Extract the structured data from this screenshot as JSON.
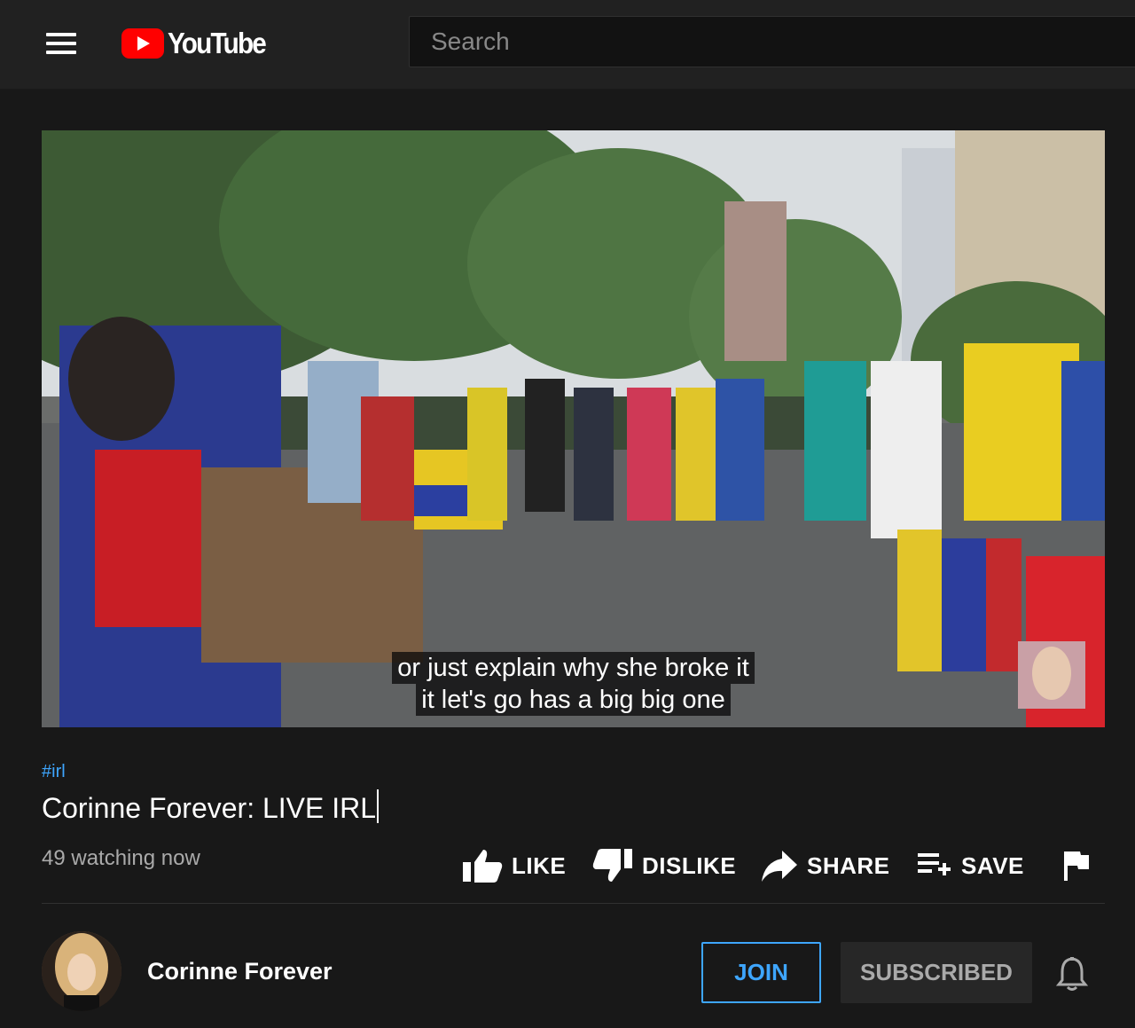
{
  "header": {
    "logo_text": "YouTube",
    "search_placeholder": "Search"
  },
  "video": {
    "captions": [
      "or just explain why she broke it",
      "it let's go has a big big one"
    ]
  },
  "info": {
    "hashtag": "#irl",
    "title": "Corinne Forever: LIVE IRL",
    "views": "49 watching now"
  },
  "actions": {
    "like": "LIKE",
    "dislike": "DISLIKE",
    "share": "SHARE",
    "save": "SAVE"
  },
  "channel": {
    "name": "Corinne Forever",
    "join": "JOIN",
    "subscribed": "SUBSCRIBED"
  },
  "colors": {
    "background": "#181818",
    "header": "#212121",
    "accent_blue": "#3ea6ff",
    "brand_red": "#ff0000"
  }
}
